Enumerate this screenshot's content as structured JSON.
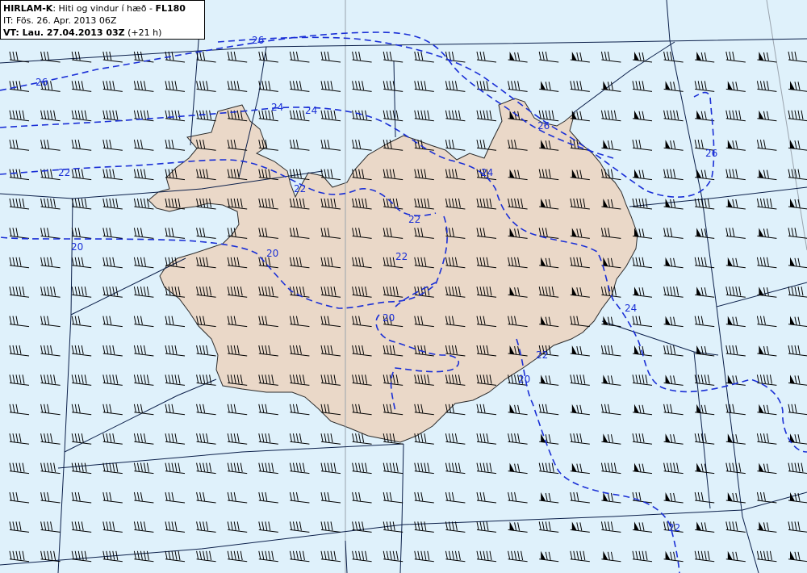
{
  "title": {
    "model": "HIRLAM-K",
    "description": ": Hiti og vindur í hæð - ",
    "level": "FL180",
    "issue_time": "IT: Fös. 26. Apr. 2013 06Z",
    "valid_prefix": "VT: Lau. 27.04.2013 03Z",
    "valid_suffix": " (+21 h)"
  },
  "contour_labels": [
    "26",
    "26",
    "24",
    "24",
    "22",
    "22",
    "20",
    "20",
    "22",
    "22",
    "24",
    "26",
    "26",
    "20",
    "20",
    "22",
    "24",
    "22"
  ],
  "colors": {
    "sea": "#dff1fb",
    "land": "#ead8c8",
    "contour": "#1a2fd6",
    "grid": "#0b1f4a"
  },
  "wind_barbs": {
    "rows": 18,
    "cols": 26
  }
}
